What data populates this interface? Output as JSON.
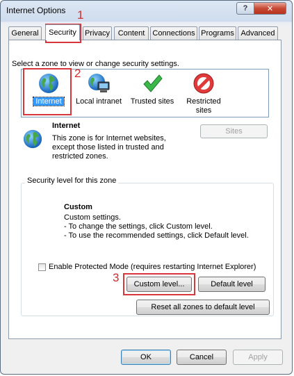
{
  "window": {
    "title": "Internet Options",
    "help_glyph": "?",
    "close_glyph": "✕"
  },
  "tabs": [
    {
      "label": "General"
    },
    {
      "label": "Security",
      "active": true
    },
    {
      "label": "Privacy"
    },
    {
      "label": "Content"
    },
    {
      "label": "Connections"
    },
    {
      "label": "Programs"
    },
    {
      "label": "Advanced"
    }
  ],
  "zones": {
    "caption": "Select a zone to view or change security settings.",
    "items": [
      {
        "label": "Internet",
        "icon": "globe-icon",
        "selected": true
      },
      {
        "label": "Local intranet",
        "icon": "intranet-icon"
      },
      {
        "label": "Trusted sites",
        "icon": "checkmark-icon"
      },
      {
        "label": "Restricted sites",
        "icon": "restricted-icon"
      }
    ]
  },
  "zone_info": {
    "title": "Internet",
    "description": "This zone is for Internet websites, except those listed in trusted and restricted zones.",
    "sites_button": "Sites"
  },
  "security_level": {
    "group_label": "Security level for this zone",
    "level_title": "Custom",
    "lines": [
      "Custom settings.",
      "- To change the settings, click Custom level.",
      "- To use the recommended settings, click Default level."
    ],
    "protected_mode_label": "Enable Protected Mode (requires restarting Internet Explorer)",
    "protected_mode_checked": false,
    "custom_level_button": "Custom level...",
    "default_level_button": "Default level",
    "reset_button": "Reset all zones to default level"
  },
  "footer": {
    "ok": "OK",
    "cancel": "Cancel",
    "apply": "Apply"
  },
  "annotations": {
    "step1": "1",
    "step2": "2",
    "step3": "3",
    "highlight_color": "#d9353c"
  }
}
